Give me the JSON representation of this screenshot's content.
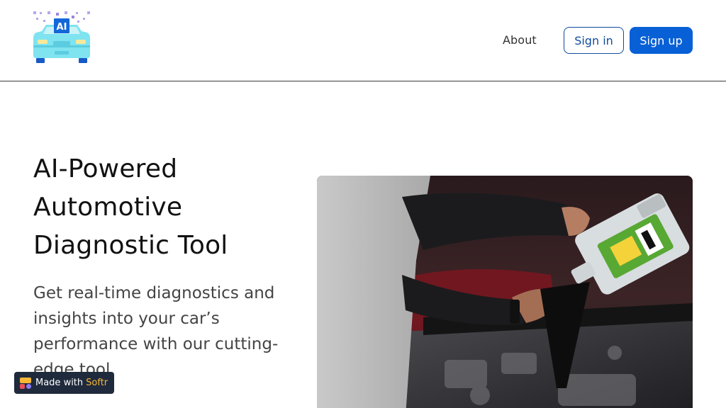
{
  "header": {
    "logo_text": "AI",
    "nav": {
      "about_label": "About"
    },
    "signin_label": "Sign in",
    "signup_label": "Sign up"
  },
  "hero": {
    "title": "AI-Powered Automotive Diagnostic Tool",
    "subtitle": "Get real-time diagnostics and insights into your car’s performance with our cutting-edge tool"
  },
  "badge": {
    "prefix": "Made with",
    "brand": "Softr"
  },
  "colors": {
    "primary": "#0860d6",
    "outline": "#0f4c9c",
    "logo_car": "#7fe3f0",
    "badge_bg": "#1f2a3c",
    "badge_brand": "#f7b836"
  }
}
